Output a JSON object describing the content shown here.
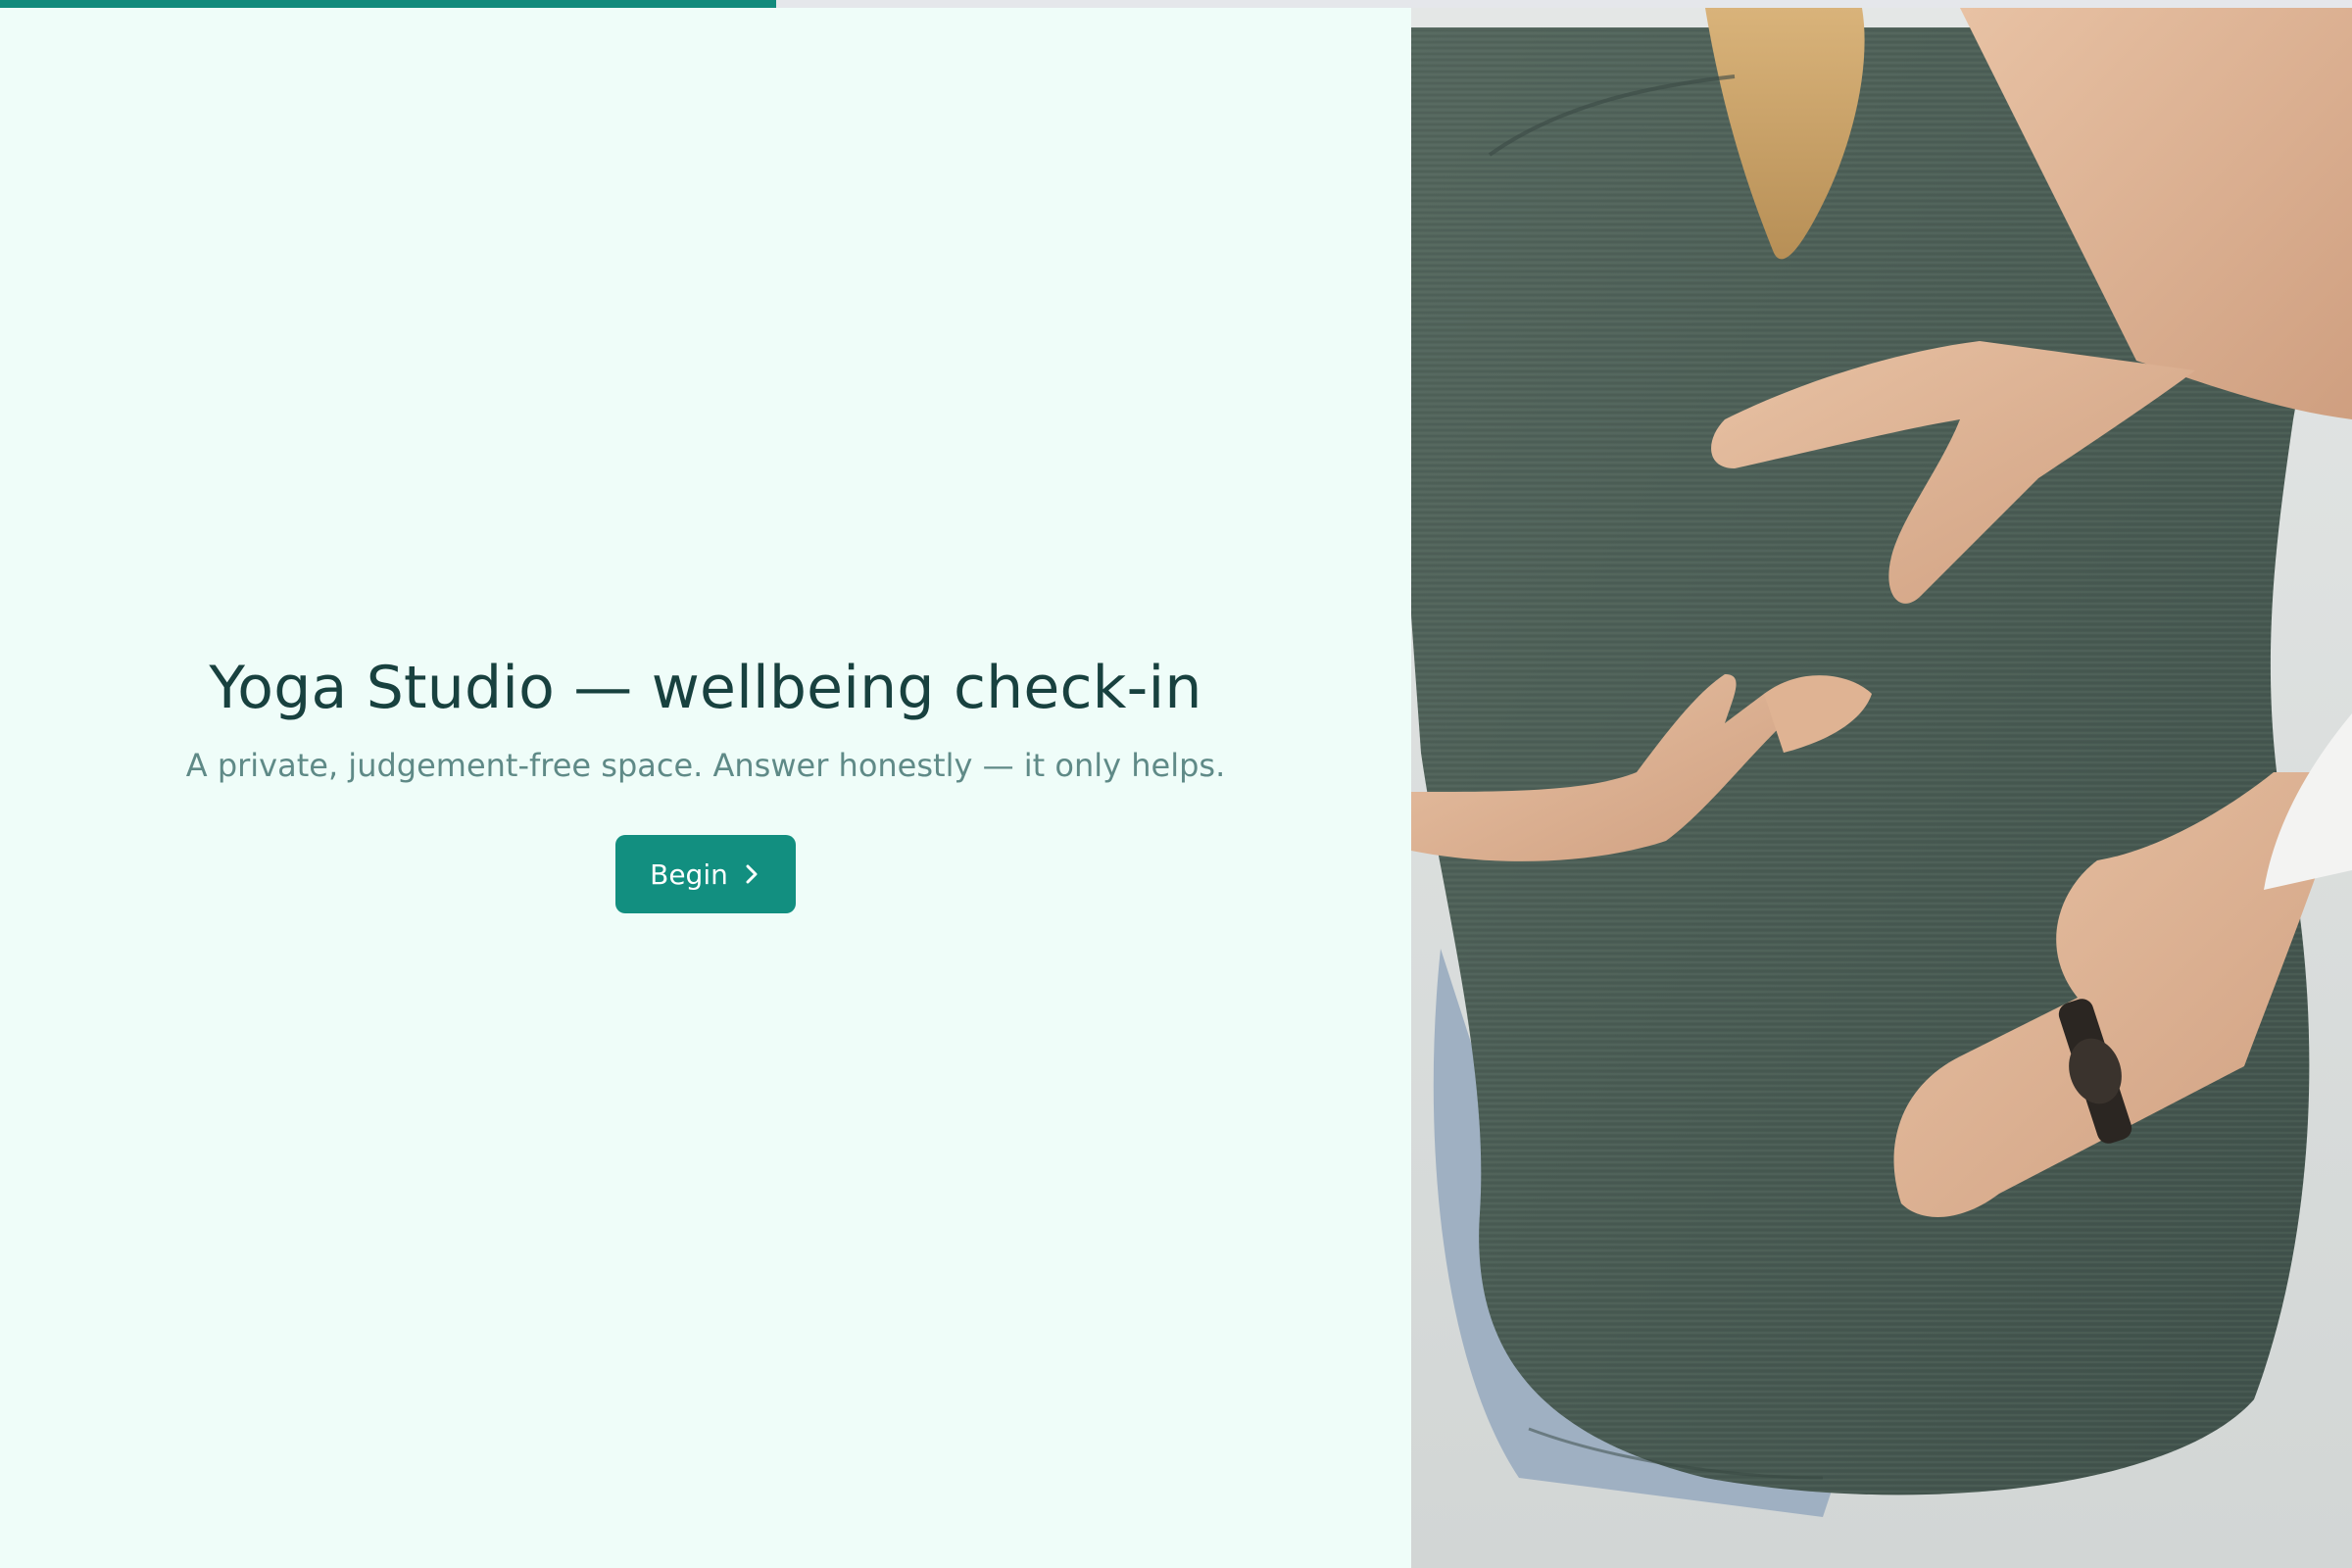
{
  "progress": {
    "fraction": 0.33,
    "color": "#128a7c"
  },
  "intro": {
    "title": "Yoga Studio — wellbeing check-in",
    "subtitle": "A private, judgement-free space. Answer honestly — it only helps.",
    "begin_label": "Begin"
  },
  "icons": {
    "begin_arrow": "chevron-right-icon"
  },
  "colors": {
    "background": "#effdf9",
    "accent": "#128f80",
    "title": "#18413f",
    "subtitle": "#5f8a87"
  }
}
